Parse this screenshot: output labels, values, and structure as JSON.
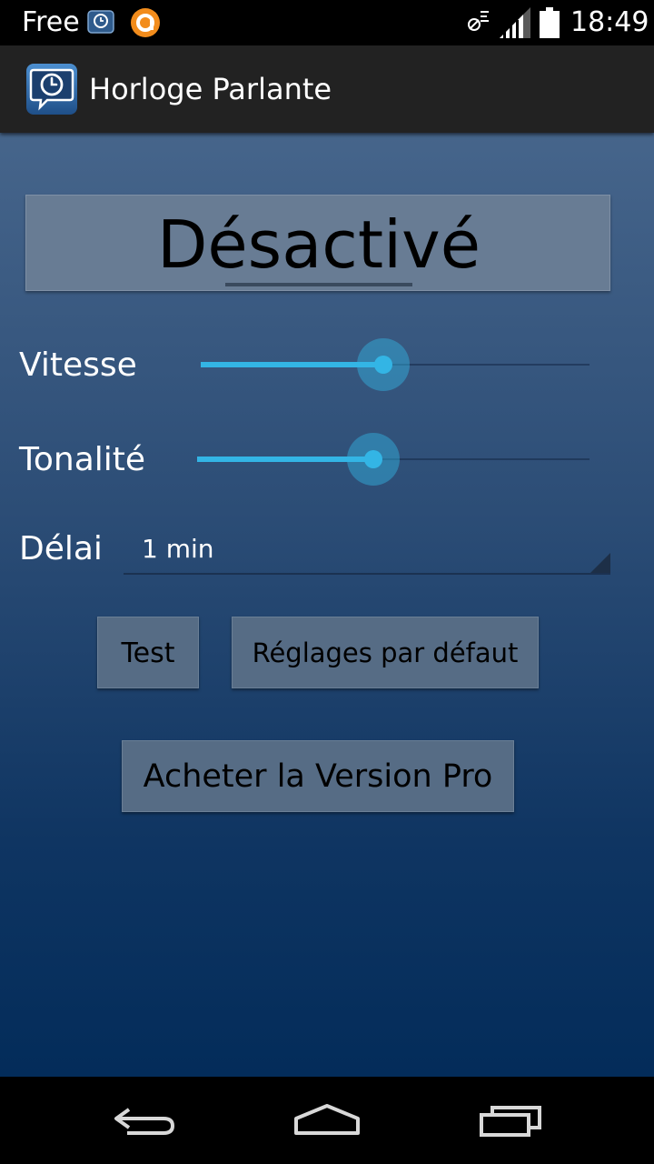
{
  "status_bar": {
    "carrier": "Free",
    "time": "18:49",
    "icons": [
      "talking-clock-notification-icon",
      "orange-a-notification-icon",
      "silent-mode-icon",
      "signal-icon",
      "battery-icon"
    ]
  },
  "action_bar": {
    "title": "Horloge Parlante",
    "icon": "clock-speech-bubble-icon"
  },
  "main": {
    "toggle_label": "Désactivé",
    "speed": {
      "label": "Vitesse",
      "value_fraction": 0.47
    },
    "pitch": {
      "label": "Tonalité",
      "value_fraction": 0.45
    },
    "delay": {
      "label": "Délai",
      "value": "1 min"
    },
    "test_label": "Test",
    "defaults_label": "Réglages par défaut",
    "buy_pro_label": "Acheter la Version Pro"
  },
  "nav_bar": {
    "icons": [
      "back-icon",
      "home-icon",
      "recent-apps-icon"
    ]
  },
  "colors": {
    "accent": "#33b5e5",
    "action_bar": "#222222",
    "gradient_top": "#46658b",
    "gradient_bottom": "#032c5a"
  }
}
